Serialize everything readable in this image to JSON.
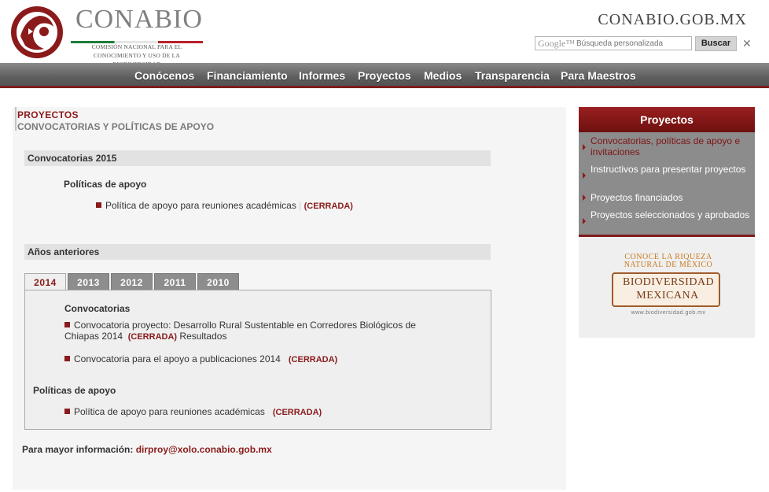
{
  "header": {
    "brand_name": "CONABIO",
    "brand_sub_line1": "COMISIÓN NACIONAL PARA EL",
    "brand_sub_line2": "CONOCIMIENTO Y USO DE LA BIODIVERSIDAD",
    "site_url": "CONABIO.GOB.MX",
    "search": {
      "google_mark": "Google™",
      "placeholder": "Búsqueda personalizada",
      "button_label": "Buscar",
      "close_glyph": "✕"
    }
  },
  "nav": {
    "items": [
      "Conócenos",
      "Financiamiento",
      "Informes",
      "Proyectos",
      "Medios",
      "Transparencia",
      "Para Maestros"
    ]
  },
  "main": {
    "section_title": "PROYECTOS",
    "section_subtitle": "CONVOCATORIAS Y POLÍTICAS DE APOYO",
    "current_year": {
      "heading": "Convocatorias 2015",
      "subheading": "Políticas de apoyo",
      "item_text": "Política de apoyo para reuniones académicas",
      "item_status": "(CERRADA)"
    },
    "previous": {
      "heading": "Años anteriores",
      "tabs": [
        "2014",
        "2013",
        "2012",
        "2011",
        "2010"
      ],
      "active_tab": "2014",
      "convocatorias_heading": "Convocatorias",
      "conv_item1_text": "Convocatoria proyecto: Desarrollo Rural Sustentable en Corredores Biológicos de Chiapas 2014",
      "conv_item1_status": "(CERRADA)",
      "conv_item1_extra": "Resultados",
      "conv_item2_text": "Convocatoria para el apoyo a publicaciones 2014",
      "conv_item2_status": "(CERRADA)",
      "politicas_heading": "Políticas de apoyo",
      "pol_item_text": "Política de apoyo para reuniones académicas",
      "pol_item_status": "(CERRADA)"
    },
    "more_info_label": "Para mayor información:",
    "more_info_email": "dirproy@xolo.conabio.gob.mx"
  },
  "sidebar": {
    "title": "Proyectos",
    "items": [
      {
        "label": "Convocatorias, políticas de apoyo e invitaciones"
      },
      {
        "label": "Instructivos para presentar proyectos"
      },
      {
        "label": "Proyectos financiados"
      },
      {
        "label": "Proyectos seleccionados y aprobados"
      }
    ],
    "active_index": 0,
    "banner": {
      "top_line1": "CONOCE LA RIQUEZA",
      "top_line2": "NATURAL DE MÉXICO",
      "mid_line1": "BIODIVERSIDAD",
      "mid_line2": "MEXICANA",
      "url": "www.biodiversidad.gob.mx"
    }
  },
  "colors": {
    "accent": "#8b1a1a",
    "nav_bg": "#5f5f5f",
    "panel_bg": "#f5f5f5"
  }
}
